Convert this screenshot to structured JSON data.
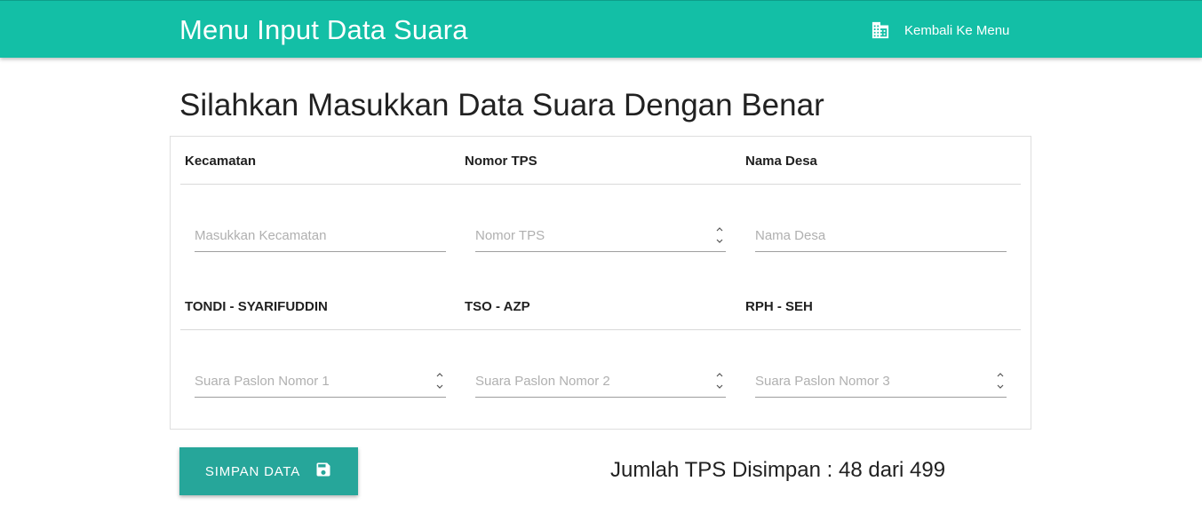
{
  "navbar": {
    "title": "Menu Input Data Suara",
    "back_link": {
      "label": "Kembali Ke Menu",
      "icon": "building-icon"
    }
  },
  "heading": "Silahkan Masukkan Data Suara Dengan Benar",
  "form": {
    "row1": {
      "labels": [
        "Kecamatan",
        "Nomor TPS",
        "Nama Desa"
      ],
      "fields": [
        {
          "placeholder": "Masukkan Kecamatan",
          "value": "",
          "type": "text"
        },
        {
          "placeholder": "Nomor TPS",
          "value": "",
          "type": "number"
        },
        {
          "placeholder": "Nama Desa",
          "value": "",
          "type": "text"
        }
      ]
    },
    "row2": {
      "labels": [
        "TONDI - SYARIFUDDIN",
        "TSO - AZP",
        "RPH - SEH"
      ],
      "fields": [
        {
          "placeholder": "Suara Paslon Nomor 1",
          "value": "",
          "type": "number"
        },
        {
          "placeholder": "Suara Paslon Nomor 2",
          "value": "",
          "type": "number"
        },
        {
          "placeholder": "Suara Paslon Nomor 3",
          "value": "",
          "type": "number"
        }
      ]
    }
  },
  "save_button": {
    "label": "SIMPAN DATA",
    "icon": "save-icon"
  },
  "tps_count": "Jumlah TPS Disimpan : 48 dari 499",
  "colors": {
    "navbar": "#13bfa6",
    "button": "#26a69a"
  }
}
